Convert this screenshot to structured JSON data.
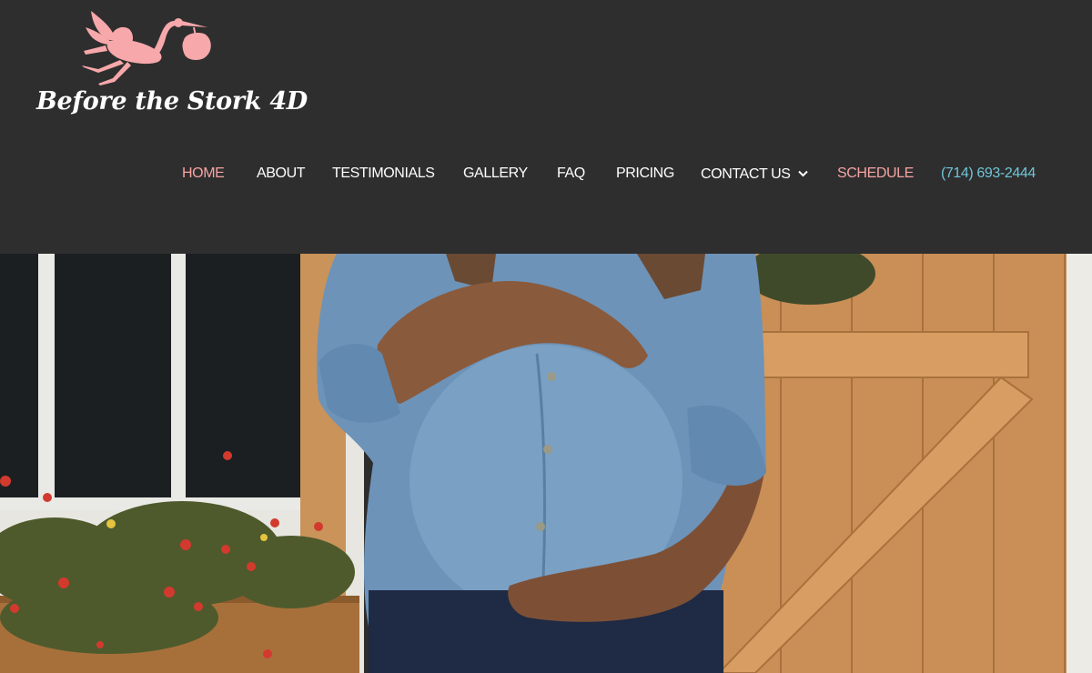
{
  "brand": {
    "name": "Before the Stork 4D",
    "logo_icon": "stork-carrying-bundle-icon",
    "logo_color": "#f7a8ab"
  },
  "nav": {
    "items": [
      {
        "label": "HOME",
        "active": true
      },
      {
        "label": "ABOUT"
      },
      {
        "label": "TESTIMONIALS"
      },
      {
        "label": "GALLERY"
      },
      {
        "label": "FAQ"
      },
      {
        "label": "PRICING"
      },
      {
        "label": "CONTACT US",
        "icon": "chevron-down-icon"
      },
      {
        "label": "SCHEDULE"
      },
      {
        "label": "(714) 693-2444"
      }
    ]
  },
  "colors": {
    "header_bg": "#2e2e2e",
    "accent_pink": "#f7a3a3",
    "accent_teal": "#6fc6d8"
  }
}
